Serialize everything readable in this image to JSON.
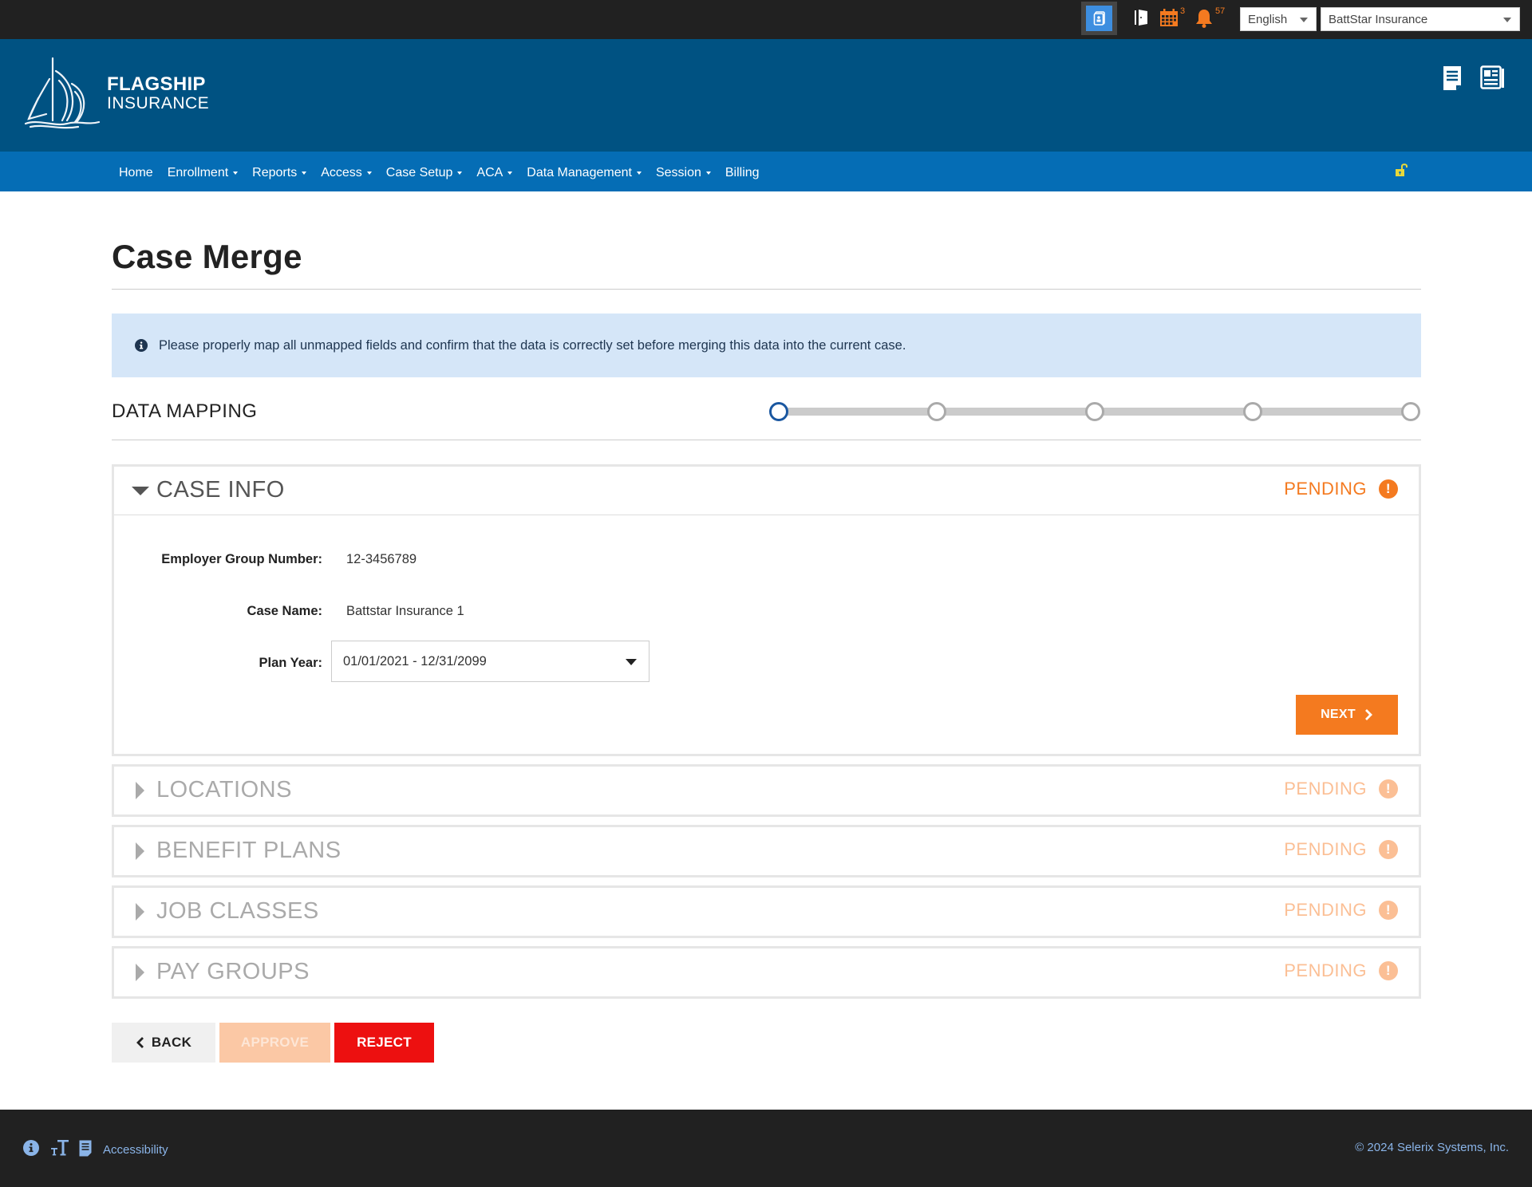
{
  "topbar": {
    "calendar_badge": "3",
    "notifications_badge": "57",
    "language": "English",
    "company": "BattStar Insurance"
  },
  "header": {
    "logo_line1": "FLAGSHIP",
    "logo_line2": "INSURANCE"
  },
  "nav": {
    "items": [
      {
        "label": "Home",
        "dropdown": false
      },
      {
        "label": "Enrollment",
        "dropdown": true
      },
      {
        "label": "Reports",
        "dropdown": true
      },
      {
        "label": "Access",
        "dropdown": true
      },
      {
        "label": "Case Setup",
        "dropdown": true
      },
      {
        "label": "ACA",
        "dropdown": true
      },
      {
        "label": "Data Management",
        "dropdown": true
      },
      {
        "label": "Session",
        "dropdown": true
      },
      {
        "label": "Billing",
        "dropdown": false
      }
    ]
  },
  "page": {
    "title": "Case Merge",
    "alert": "Please properly map all unmapped fields and confirm that the data is correctly set before merging this data into the current case.",
    "section_title": "DATA MAPPING",
    "stepper": {
      "total_steps": 5,
      "current_step": 1
    }
  },
  "panels": [
    {
      "title": "CASE INFO",
      "status": "PENDING",
      "expanded": true,
      "fields": {
        "employer_group_number_label": "Employer Group Number:",
        "employer_group_number": "12-3456789",
        "case_name_label": "Case Name:",
        "case_name": "Battstar Insurance 1",
        "plan_year_label": "Plan Year:",
        "plan_year": "01/01/2021 - 12/31/2099"
      },
      "next_label": "NEXT"
    },
    {
      "title": "LOCATIONS",
      "status": "PENDING",
      "expanded": false
    },
    {
      "title": "BENEFIT PLANS",
      "status": "PENDING",
      "expanded": false
    },
    {
      "title": "JOB CLASSES",
      "status": "PENDING",
      "expanded": false
    },
    {
      "title": "PAY GROUPS",
      "status": "PENDING",
      "expanded": false
    }
  ],
  "actions": {
    "back": "BACK",
    "approve": "APPROVE",
    "reject": "REJECT"
  },
  "footer": {
    "accessibility": "Accessibility",
    "copyright": "© 2024 Selerix Systems, Inc."
  },
  "colors": {
    "header_bg": "#005282",
    "nav_bg": "#056db5",
    "accent_orange": "#f47a1f",
    "reject_red": "#ed1010",
    "active_step": "#1a57a0"
  }
}
